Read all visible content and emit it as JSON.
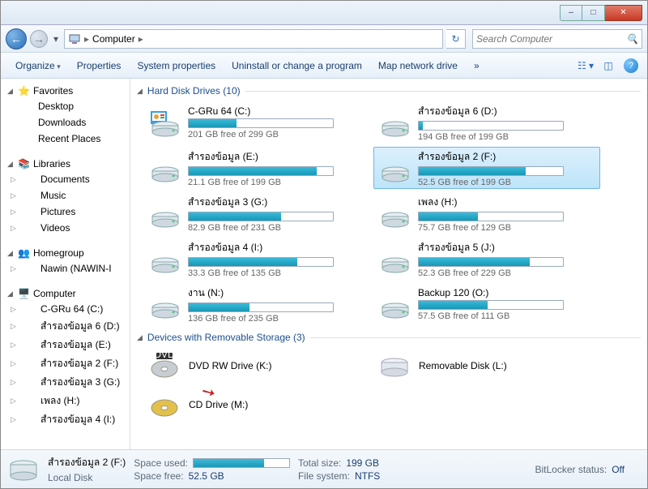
{
  "window": {
    "min": "–",
    "max": "□",
    "close": "✕"
  },
  "nav": {
    "breadcrumb_label": "Computer",
    "search_placeholder": "Search Computer"
  },
  "toolbar": {
    "organize": "Organize",
    "properties": "Properties",
    "system_properties": "System properties",
    "uninstall": "Uninstall or change a program",
    "map_drive": "Map network drive",
    "more": "»"
  },
  "sidebar": {
    "favorites": {
      "label": "Favorites",
      "items": [
        "Desktop",
        "Downloads",
        "Recent Places"
      ]
    },
    "libraries": {
      "label": "Libraries",
      "items": [
        "Documents",
        "Music",
        "Pictures",
        "Videos"
      ]
    },
    "homegroup": {
      "label": "Homegroup",
      "items": [
        "Nawin (NAWIN-I"
      ]
    },
    "computer": {
      "label": "Computer",
      "items": [
        "C-GRu 64 (C:)",
        "สำรองข้อมูล 6 (D:)",
        "สำรองข้อมูล (E:)",
        "สำรองข้อมูล 2 (F:)",
        "สำรองข้อมูล 3 (G:)",
        "เพลง (H:)",
        "สำรองข้อมูล 4 (I:)"
      ]
    }
  },
  "groups": {
    "hdd": {
      "label": "Hard Disk Drives (10)"
    },
    "removable": {
      "label": "Devices with Removable Storage (3)"
    }
  },
  "drives": [
    {
      "name": "C-GRu 64 (C:)",
      "free": "201 GB free of 299 GB",
      "pct": 33,
      "os": true
    },
    {
      "name": "สำรองข้อมูล 6 (D:)",
      "free": "194 GB free of 199 GB",
      "pct": 3
    },
    {
      "name": "สำรองข้อมูล (E:)",
      "free": "21.1 GB free of 199 GB",
      "pct": 89
    },
    {
      "name": "สำรองข้อมูล 2 (F:)",
      "free": "52.5 GB free of 199 GB",
      "pct": 74,
      "selected": true
    },
    {
      "name": "สำรองข้อมูล 3 (G:)",
      "free": "82.9 GB free of 231 GB",
      "pct": 64
    },
    {
      "name": "เพลง (H:)",
      "free": "75.7 GB free of 129 GB",
      "pct": 41
    },
    {
      "name": "สำรองข้อมูล 4 (I:)",
      "free": "33.3 GB free of 135 GB",
      "pct": 75
    },
    {
      "name": "สำรองข้อมูล 5 (J:)",
      "free": "52.3 GB free of 229 GB",
      "pct": 77
    },
    {
      "name": "งาน (N:)",
      "free": "136 GB free of 235 GB",
      "pct": 42
    },
    {
      "name": "Backup 120 (O:)",
      "free": "57.5 GB free of 111 GB",
      "pct": 48
    }
  ],
  "removable": [
    {
      "name": "DVD RW Drive (K:)",
      "kind": "dvd"
    },
    {
      "name": "Removable Disk (L:)",
      "kind": "removable"
    },
    {
      "name": "CD Drive (M:)",
      "kind": "cd"
    }
  ],
  "details": {
    "title": "สำรองข้อมูล 2 (F:)",
    "subtitle": "Local Disk",
    "space_used_label": "Space used:",
    "space_free_label": "Space free:",
    "space_free": "52.5 GB",
    "total_size_label": "Total size:",
    "total_size": "199 GB",
    "fs_label": "File system:",
    "fs": "NTFS",
    "bitlocker_label": "BitLocker status:",
    "bitlocker": "Off",
    "used_pct": 74
  }
}
